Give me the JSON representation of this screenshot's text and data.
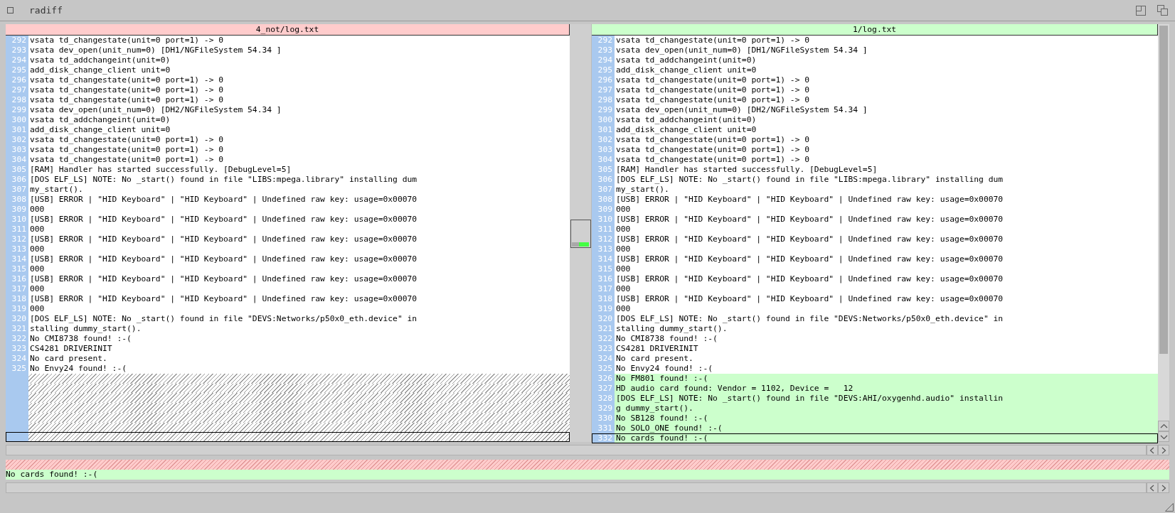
{
  "window": {
    "title": "radiff"
  },
  "panes": [
    {
      "title": "4_not/log.txt",
      "kind": "old",
      "rows": [
        {
          "number": "292",
          "text": "vsata td_changestate(unit=0 port=1) -> 0",
          "kind": "same",
          "selected": false
        },
        {
          "number": "293",
          "text": "vsata dev_open(unit_num=0) [DH1/NGFileSystem 54.34 ]",
          "kind": "same",
          "selected": false
        },
        {
          "number": "294",
          "text": "vsata td_addchangeint(unit=0)",
          "kind": "same",
          "selected": false
        },
        {
          "number": "295",
          "text": "add_disk_change_client unit=0",
          "kind": "same",
          "selected": false
        },
        {
          "number": "296",
          "text": "vsata td_changestate(unit=0 port=1) -> 0",
          "kind": "same",
          "selected": false
        },
        {
          "number": "297",
          "text": "vsata td_changestate(unit=0 port=1) -> 0",
          "kind": "same",
          "selected": false
        },
        {
          "number": "298",
          "text": "vsata td_changestate(unit=0 port=1) -> 0",
          "kind": "same",
          "selected": false
        },
        {
          "number": "299",
          "text": "vsata dev_open(unit_num=0) [DH2/NGFileSystem 54.34 ]",
          "kind": "same",
          "selected": false
        },
        {
          "number": "300",
          "text": "vsata td_addchangeint(unit=0)",
          "kind": "same",
          "selected": false
        },
        {
          "number": "301",
          "text": "add_disk_change_client unit=0",
          "kind": "same",
          "selected": false
        },
        {
          "number": "302",
          "text": "vsata td_changestate(unit=0 port=1) -> 0",
          "kind": "same",
          "selected": false
        },
        {
          "number": "303",
          "text": "vsata td_changestate(unit=0 port=1) -> 0",
          "kind": "same",
          "selected": false
        },
        {
          "number": "304",
          "text": "vsata td_changestate(unit=0 port=1) -> 0",
          "kind": "same",
          "selected": false
        },
        {
          "number": "305",
          "text": "[RAM] Handler has started successfully. [DebugLevel=5]",
          "kind": "same",
          "selected": false
        },
        {
          "number": "306",
          "text": "[DOS ELF_LS] NOTE: No _start() found in file \"LIBS:mpega.library\" installing dum",
          "kind": "same",
          "selected": false
        },
        {
          "number": "307",
          "text": "my_start().",
          "kind": "same",
          "selected": false
        },
        {
          "number": "308",
          "text": "[USB] ERROR | \"HID Keyboard\" | \"HID Keyboard\" | Undefined raw key: usage=0x00070",
          "kind": "same",
          "selected": false
        },
        {
          "number": "309",
          "text": "000",
          "kind": "same",
          "selected": false
        },
        {
          "number": "310",
          "text": "[USB] ERROR | \"HID Keyboard\" | \"HID Keyboard\" | Undefined raw key: usage=0x00070",
          "kind": "same",
          "selected": false
        },
        {
          "number": "311",
          "text": "000",
          "kind": "same",
          "selected": false
        },
        {
          "number": "312",
          "text": "[USB] ERROR | \"HID Keyboard\" | \"HID Keyboard\" | Undefined raw key: usage=0x00070",
          "kind": "same",
          "selected": false
        },
        {
          "number": "313",
          "text": "000",
          "kind": "same",
          "selected": false
        },
        {
          "number": "314",
          "text": "[USB] ERROR | \"HID Keyboard\" | \"HID Keyboard\" | Undefined raw key: usage=0x00070",
          "kind": "same",
          "selected": false
        },
        {
          "number": "315",
          "text": "000",
          "kind": "same",
          "selected": false
        },
        {
          "number": "316",
          "text": "[USB] ERROR | \"HID Keyboard\" | \"HID Keyboard\" | Undefined raw key: usage=0x00070",
          "kind": "same",
          "selected": false
        },
        {
          "number": "317",
          "text": "000",
          "kind": "same",
          "selected": false
        },
        {
          "number": "318",
          "text": "[USB] ERROR | \"HID Keyboard\" | \"HID Keyboard\" | Undefined raw key: usage=0x00070",
          "kind": "same",
          "selected": false
        },
        {
          "number": "319",
          "text": "000",
          "kind": "same",
          "selected": false
        },
        {
          "number": "320",
          "text": "[DOS ELF_LS] NOTE: No _start() found in file \"DEVS:Networks/p50x0_eth.device\" in",
          "kind": "same",
          "selected": false
        },
        {
          "number": "321",
          "text": "stalling dummy_start().",
          "kind": "same",
          "selected": false
        },
        {
          "number": "322",
          "text": "No CMI8738 found! :-(",
          "kind": "same",
          "selected": false
        },
        {
          "number": "323",
          "text": "CS4281 DRIVERINIT",
          "kind": "same",
          "selected": false
        },
        {
          "number": "324",
          "text": "No card present.",
          "kind": "same",
          "selected": false
        },
        {
          "number": "325",
          "text": "No Envy24 found! :-(",
          "kind": "same",
          "selected": false
        },
        {
          "kind": "gap",
          "selected": false
        },
        {
          "kind": "gap",
          "selected": false
        },
        {
          "kind": "gap",
          "selected": false
        },
        {
          "kind": "gap",
          "selected": false
        },
        {
          "kind": "gap",
          "selected": false
        },
        {
          "kind": "gap",
          "selected": false
        },
        {
          "kind": "gap",
          "selected": true
        }
      ]
    },
    {
      "title": "1/log.txt",
      "kind": "new",
      "rows": [
        {
          "number": "292",
          "text": "vsata td_changestate(unit=0 port=1) -> 0",
          "kind": "same",
          "selected": false
        },
        {
          "number": "293",
          "text": "vsata dev_open(unit_num=0) [DH1/NGFileSystem 54.34 ]",
          "kind": "same",
          "selected": false
        },
        {
          "number": "294",
          "text": "vsata td_addchangeint(unit=0)",
          "kind": "same",
          "selected": false
        },
        {
          "number": "295",
          "text": "add_disk_change_client unit=0",
          "kind": "same",
          "selected": false
        },
        {
          "number": "296",
          "text": "vsata td_changestate(unit=0 port=1) -> 0",
          "kind": "same",
          "selected": false
        },
        {
          "number": "297",
          "text": "vsata td_changestate(unit=0 port=1) -> 0",
          "kind": "same",
          "selected": false
        },
        {
          "number": "298",
          "text": "vsata td_changestate(unit=0 port=1) -> 0",
          "kind": "same",
          "selected": false
        },
        {
          "number": "299",
          "text": "vsata dev_open(unit_num=0) [DH2/NGFileSystem 54.34 ]",
          "kind": "same",
          "selected": false
        },
        {
          "number": "300",
          "text": "vsata td_addchangeint(unit=0)",
          "kind": "same",
          "selected": false
        },
        {
          "number": "301",
          "text": "add_disk_change_client unit=0",
          "kind": "same",
          "selected": false
        },
        {
          "number": "302",
          "text": "vsata td_changestate(unit=0 port=1) -> 0",
          "kind": "same",
          "selected": false
        },
        {
          "number": "303",
          "text": "vsata td_changestate(unit=0 port=1) -> 0",
          "kind": "same",
          "selected": false
        },
        {
          "number": "304",
          "text": "vsata td_changestate(unit=0 port=1) -> 0",
          "kind": "same",
          "selected": false
        },
        {
          "number": "305",
          "text": "[RAM] Handler has started successfully. [DebugLevel=5]",
          "kind": "same",
          "selected": false
        },
        {
          "number": "306",
          "text": "[DOS ELF_LS] NOTE: No _start() found in file \"LIBS:mpega.library\" installing dum",
          "kind": "same",
          "selected": false
        },
        {
          "number": "307",
          "text": "my_start().",
          "kind": "same",
          "selected": false
        },
        {
          "number": "308",
          "text": "[USB] ERROR | \"HID Keyboard\" | \"HID Keyboard\" | Undefined raw key: usage=0x00070",
          "kind": "same",
          "selected": false
        },
        {
          "number": "309",
          "text": "000",
          "kind": "same",
          "selected": false
        },
        {
          "number": "310",
          "text": "[USB] ERROR | \"HID Keyboard\" | \"HID Keyboard\" | Undefined raw key: usage=0x00070",
          "kind": "same",
          "selected": false
        },
        {
          "number": "311",
          "text": "000",
          "kind": "same",
          "selected": false
        },
        {
          "number": "312",
          "text": "[USB] ERROR | \"HID Keyboard\" | \"HID Keyboard\" | Undefined raw key: usage=0x00070",
          "kind": "same",
          "selected": false
        },
        {
          "number": "313",
          "text": "000",
          "kind": "same",
          "selected": false
        },
        {
          "number": "314",
          "text": "[USB] ERROR | \"HID Keyboard\" | \"HID Keyboard\" | Undefined raw key: usage=0x00070",
          "kind": "same",
          "selected": false
        },
        {
          "number": "315",
          "text": "000",
          "kind": "same",
          "selected": false
        },
        {
          "number": "316",
          "text": "[USB] ERROR | \"HID Keyboard\" | \"HID Keyboard\" | Undefined raw key: usage=0x00070",
          "kind": "same",
          "selected": false
        },
        {
          "number": "317",
          "text": "000",
          "kind": "same",
          "selected": false
        },
        {
          "number": "318",
          "text": "[USB] ERROR | \"HID Keyboard\" | \"HID Keyboard\" | Undefined raw key: usage=0x00070",
          "kind": "same",
          "selected": false
        },
        {
          "number": "319",
          "text": "000",
          "kind": "same",
          "selected": false
        },
        {
          "number": "320",
          "text": "[DOS ELF_LS] NOTE: No _start() found in file \"DEVS:Networks/p50x0_eth.device\" in",
          "kind": "same",
          "selected": false
        },
        {
          "number": "321",
          "text": "stalling dummy_start().",
          "kind": "same",
          "selected": false
        },
        {
          "number": "322",
          "text": "No CMI8738 found! :-(",
          "kind": "same",
          "selected": false
        },
        {
          "number": "323",
          "text": "CS4281 DRIVERINIT",
          "kind": "same",
          "selected": false
        },
        {
          "number": "324",
          "text": "No card present.",
          "kind": "same",
          "selected": false
        },
        {
          "number": "325",
          "text": "No Envy24 found! :-(",
          "kind": "same",
          "selected": false
        },
        {
          "number": "326",
          "text": "No FM801 found! :-(",
          "kind": "added",
          "selected": false
        },
        {
          "number": "327",
          "text": "HD audio card found: Vendor = 1102, Device =   12",
          "kind": "added",
          "selected": false
        },
        {
          "number": "328",
          "text": "[DOS ELF_LS] NOTE: No _start() found in file \"DEVS:AHI/oxygenhd.audio\" installin",
          "kind": "added",
          "selected": false
        },
        {
          "number": "329",
          "text": "g dummy_start().",
          "kind": "added",
          "selected": false
        },
        {
          "number": "330",
          "text": "No SB128 found! :-(",
          "kind": "added",
          "selected": false
        },
        {
          "number": "331",
          "text": "No SOLO_ONE found! :-(",
          "kind": "added",
          "selected": false
        },
        {
          "number": "332",
          "text": "No cards found! :-(",
          "kind": "added",
          "selected": true
        }
      ]
    }
  ],
  "line_preview": [
    {
      "kind": "gap"
    },
    {
      "kind": "added",
      "text": "No cards found! :-("
    }
  ]
}
